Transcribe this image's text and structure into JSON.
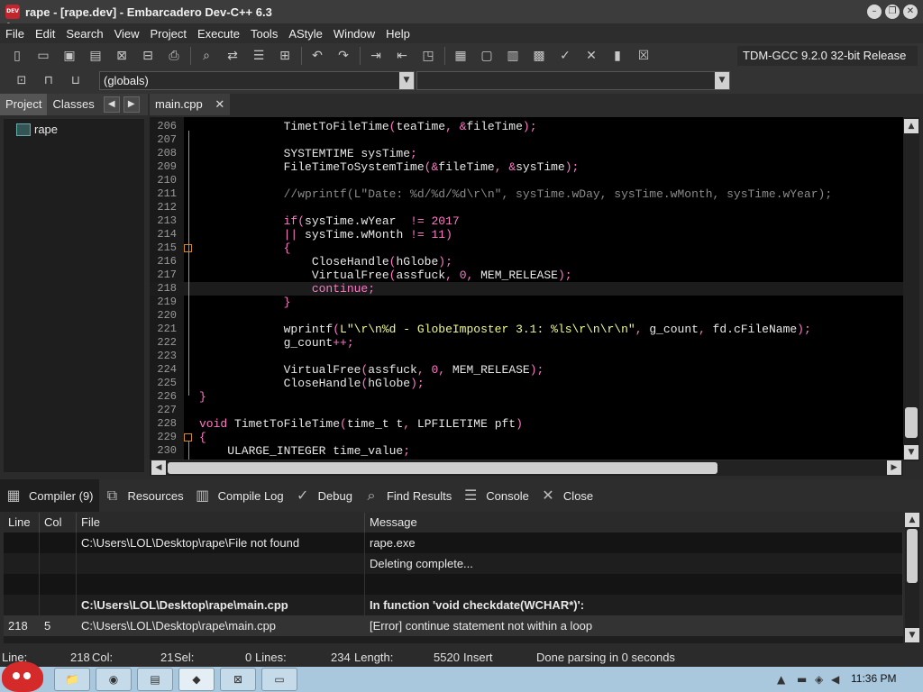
{
  "window": {
    "title": "rape - [rape.dev] - Embarcadero Dev-C++ 6.3",
    "icon_text": "DEV C++",
    "controls": [
      "minimize-icon",
      "restore-icon",
      "close-icon"
    ]
  },
  "menu": [
    "File",
    "Edit",
    "Search",
    "View",
    "Project",
    "Execute",
    "Tools",
    "AStyle",
    "Window",
    "Help"
  ],
  "toolbar": {
    "compiler": "TDM-GCC 9.2.0 32-bit Release",
    "icons": [
      "new-file-icon",
      "open-icon",
      "save-icon",
      "save-all-icon",
      "close-file-icon",
      "close-all-icon",
      "print-icon",
      "find-icon",
      "replace-icon",
      "goto-line-icon",
      "toggle-bookmark-icon",
      "undo-icon",
      "redo-icon",
      "indent-icon",
      "unindent-icon",
      "comment-icon",
      "layout-icon",
      "fullscreen-icon",
      "calculator-icon",
      "grid-icon",
      "check-icon",
      "cancel-icon",
      "chart-icon",
      "stop-icon"
    ]
  },
  "toolbar2": {
    "globals": "(globals)",
    "function_combo": ""
  },
  "left_panel": {
    "tabs": [
      "Project",
      "Classes"
    ],
    "tree": [
      {
        "label": "rape"
      }
    ]
  },
  "editor": {
    "tab": "main.cpp",
    "current_line": 218,
    "lines": [
      {
        "n": "206",
        "code": "            TimetToFileTime(teaTime, &fileTime);"
      },
      {
        "n": "207",
        "code": ""
      },
      {
        "n": "208",
        "code": "            SYSTEMTIME sysTime;"
      },
      {
        "n": "209",
        "code": "            FileTimeToSystemTime(&fileTime, &sysTime);"
      },
      {
        "n": "210",
        "code": ""
      },
      {
        "n": "211",
        "code": "            //wprintf(L\"Date: %d/%d/%d\\r\\n\", sysTime.wDay, sysTime.wMonth, sysTime.wYear);"
      },
      {
        "n": "212",
        "code": ""
      },
      {
        "n": "213",
        "code": "            if(sysTime.wYear  != 2017"
      },
      {
        "n": "214",
        "code": "            || sysTime.wMonth != 11)"
      },
      {
        "n": "215",
        "code": "            {"
      },
      {
        "n": "216",
        "code": "                CloseHandle(hGlobe);"
      },
      {
        "n": "217",
        "code": "                VirtualFree(assfuck, 0, MEM_RELEASE);"
      },
      {
        "n": "218",
        "code": "                continue;"
      },
      {
        "n": "219",
        "code": "            }"
      },
      {
        "n": "220",
        "code": ""
      },
      {
        "n": "221",
        "code": "            wprintf(L\"\\r\\n%d - GlobeImposter 3.1: %ls\\r\\n\\r\\n\", g_count, fd.cFileName);"
      },
      {
        "n": "222",
        "code": "            g_count++;"
      },
      {
        "n": "223",
        "code": ""
      },
      {
        "n": "224",
        "code": "            VirtualFree(assfuck, 0, MEM_RELEASE);"
      },
      {
        "n": "225",
        "code": "            CloseHandle(hGlobe);"
      },
      {
        "n": "226",
        "code": "}"
      },
      {
        "n": "227",
        "code": ""
      },
      {
        "n": "228",
        "code": "void TimetToFileTime(time_t t, LPFILETIME pft)"
      },
      {
        "n": "229",
        "code": "{"
      },
      {
        "n": "230",
        "code": "    ULARGE_INTEGER time_value;"
      }
    ]
  },
  "bottom_tabs": [
    {
      "label": "Compiler (9)",
      "icon": "compiler-grid-icon"
    },
    {
      "label": "Resources",
      "icon": "resources-icon"
    },
    {
      "label": "Compile Log",
      "icon": "compile-log-chart-icon"
    },
    {
      "label": "Debug",
      "icon": "debug-check-icon"
    },
    {
      "label": "Find Results",
      "icon": "find-results-icon"
    },
    {
      "label": "Console",
      "icon": "console-icon"
    },
    {
      "label": "Close",
      "icon": "close-x-icon"
    }
  ],
  "results": {
    "columns": [
      "Line",
      "Col",
      "File",
      "Message"
    ],
    "rows": [
      {
        "line": "",
        "col": "",
        "file": "C:\\Users\\LOL\\Desktop\\rape\\File not found",
        "message": "rape.exe",
        "bold": false
      },
      {
        "line": "",
        "col": "",
        "file": "",
        "message": "Deleting complete...",
        "bold": false
      },
      {
        "line": "",
        "col": "",
        "file": "",
        "message": "",
        "bold": false
      },
      {
        "line": "",
        "col": "",
        "file": "C:\\Users\\LOL\\Desktop\\rape\\main.cpp",
        "message": "In function 'void checkdate(WCHAR*)':",
        "bold": true
      },
      {
        "line": "218",
        "col": "5",
        "file": "C:\\Users\\LOL\\Desktop\\rape\\main.cpp",
        "message": "[Error] continue statement not within a loop",
        "bold": false
      }
    ]
  },
  "status": {
    "line_label": "Line:",
    "line_value": "218",
    "col_label": "Col:",
    "col_value": "21",
    "sel_label": "Sel:",
    "sel_value": "0",
    "lines_label": "Lines:",
    "lines_value": "234",
    "length_label": "Length:",
    "length_value": "5520",
    "mode": "Insert",
    "message": "Done parsing in 0 seconds"
  },
  "taskbar": {
    "time": "11:36 PM",
    "apps": [
      "explorer-icon",
      "chrome-icon",
      "notepad-icon",
      "devcpp-icon",
      "app-icon",
      "window-icon"
    ]
  }
}
